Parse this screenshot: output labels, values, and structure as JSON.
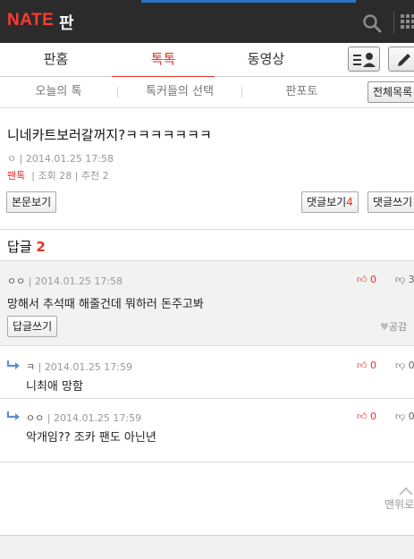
{
  "header": {
    "logo": "NATE",
    "section": "판"
  },
  "tabs": [
    "판홈",
    "톡톡",
    "동영상"
  ],
  "subtabs": [
    "오늘의 톡",
    "톡커들의 선택",
    "판포토"
  ],
  "list_button": "전체목록",
  "post": {
    "title": "니네카트보러갈꺼지?ㅋㅋㅋㅋㅋㅋㅋ",
    "author": "ㅇ",
    "date": "2014.01.25 17:58",
    "category": "팬톡",
    "views_label": "조회",
    "views": "28",
    "recommend_label": "추천",
    "recommend": "2",
    "view_body_button": "본문보기",
    "view_comments_button": "댓글보기",
    "comment_count": "4",
    "write_comment_button": "댓글쓰기"
  },
  "replies": {
    "heading": "답글",
    "count": "2"
  },
  "comments": [
    {
      "author": "ㅇㅇ",
      "date": "2014.01.25 17:58",
      "body": "망해서 추석때 해줄건데 뭐하러 돈주고봐",
      "likes": "0",
      "dislikes": "3",
      "reply_button": "답글쓰기",
      "empathy": "공감"
    },
    {
      "author": "ㅋ",
      "date": "2014.01.25 17:59",
      "body": "니최애 망함",
      "likes": "0",
      "dislikes": "0"
    },
    {
      "author": "ㅇㅇ",
      "date": "2014.01.25 17:59",
      "body": "악개임?? 조카 팬도 아닌년",
      "likes": "0",
      "dislikes": "0"
    }
  ],
  "to_top": "맨위로",
  "colors": {
    "accent": "#e3322b",
    "topbar": "#2b2b2b",
    "progress": "#2a73c9"
  }
}
